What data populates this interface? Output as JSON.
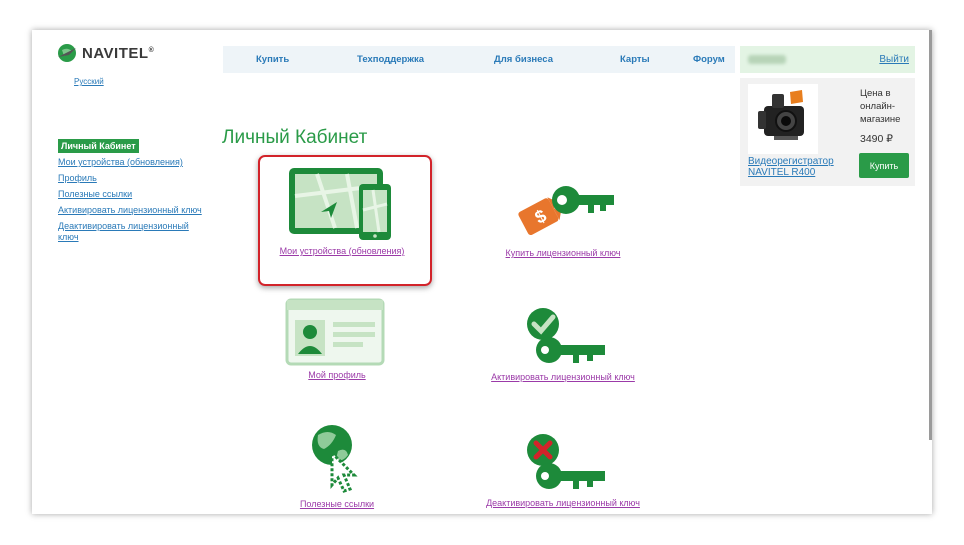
{
  "brand": {
    "name": "NAVITEL",
    "reg_mark": "®",
    "language": "Русский"
  },
  "nav": {
    "items": [
      "Купить",
      "Техподдержка",
      "Для бизнеса",
      "Карты",
      "Форум"
    ]
  },
  "user": {
    "logout_label": "Выйти"
  },
  "sidebar": {
    "active": "Личный Кабинет",
    "items": [
      "Мои устройства (обновления)",
      "Профиль",
      "Полезные ссылки",
      "Активировать лицензионный ключ",
      "Деактивировать лицензионный ключ"
    ]
  },
  "main": {
    "title": "Личный Кабинет",
    "tiles": [
      {
        "label": "Мои устройства (обновления)",
        "icon": "devices-icon",
        "highlighted": true
      },
      {
        "label": "Купить лицензионный ключ",
        "icon": "key-price-tag-icon"
      },
      {
        "label": "Мой профиль",
        "icon": "profile-card-icon"
      },
      {
        "label": "Активировать лицензионный ключ",
        "icon": "key-check-icon"
      },
      {
        "label": "Полезные ссылки",
        "icon": "globe-cursor-icon"
      },
      {
        "label": "Деактивировать лицензионный ключ",
        "icon": "key-cross-icon"
      }
    ]
  },
  "product": {
    "price_label": "Цена в онлайн-магазине",
    "price": "3490 ₽",
    "name": "Видеорегистратор NAVITEL R400",
    "buy_label": "Купить",
    "image_icon": "dashcam-icon"
  },
  "colors": {
    "brand_green": "#2a9b48",
    "link_blue": "#2a7ab8",
    "visited_purple": "#9b3aa8",
    "highlight_red": "#d2232a",
    "key_orange": "#e8762d",
    "cross_red": "#d2232a"
  }
}
